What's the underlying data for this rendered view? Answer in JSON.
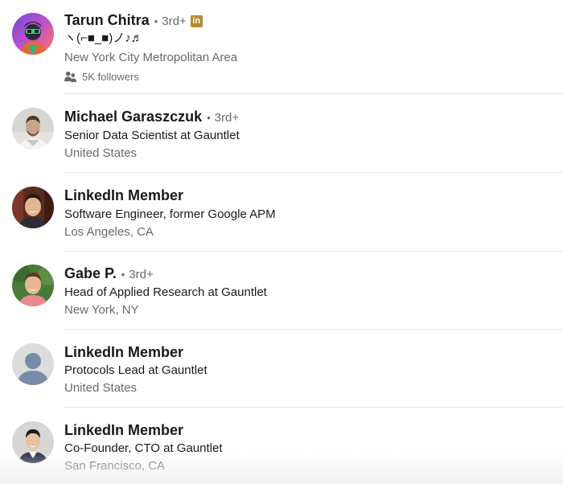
{
  "results": [
    {
      "name": "Tarun Chitra",
      "degree": "3rd+",
      "separator": "•",
      "premium_badge": "in",
      "headline": "ヽ(⌐■_■)ノ♪♬",
      "location": "New York City Metropolitan Area",
      "followers": "5K followers",
      "avatar": "avatar-cartoon-icon"
    },
    {
      "name": "Michael Garaszczuk",
      "degree": "3rd+",
      "separator": "•",
      "headline": "Senior Data Scientist at Gauntlet",
      "location": "United States",
      "avatar": "avatar-photo-icon"
    },
    {
      "name": "LinkedIn Member",
      "headline": "Software Engineer, former Google APM",
      "location": "Los Angeles, CA",
      "avatar": "avatar-photo-icon"
    },
    {
      "name": "Gabe P.",
      "degree": "3rd+",
      "separator": "•",
      "headline": "Head of Applied Research at Gauntlet",
      "location": "New York, NY",
      "avatar": "avatar-photo-icon"
    },
    {
      "name": "LinkedIn Member",
      "headline": "Protocols Lead at Gauntlet",
      "location": "United States",
      "avatar": "default-avatar-icon"
    },
    {
      "name": "LinkedIn Member",
      "headline": "Co-Founder, CTO at Gauntlet",
      "location": "San Francisco, CA",
      "avatar": "avatar-photo-icon"
    }
  ],
  "colors": {
    "premium_gold": "#b68b30",
    "text_primary": "#1a1a1a",
    "text_secondary": "#666666",
    "divider": "#e6e6e6"
  }
}
